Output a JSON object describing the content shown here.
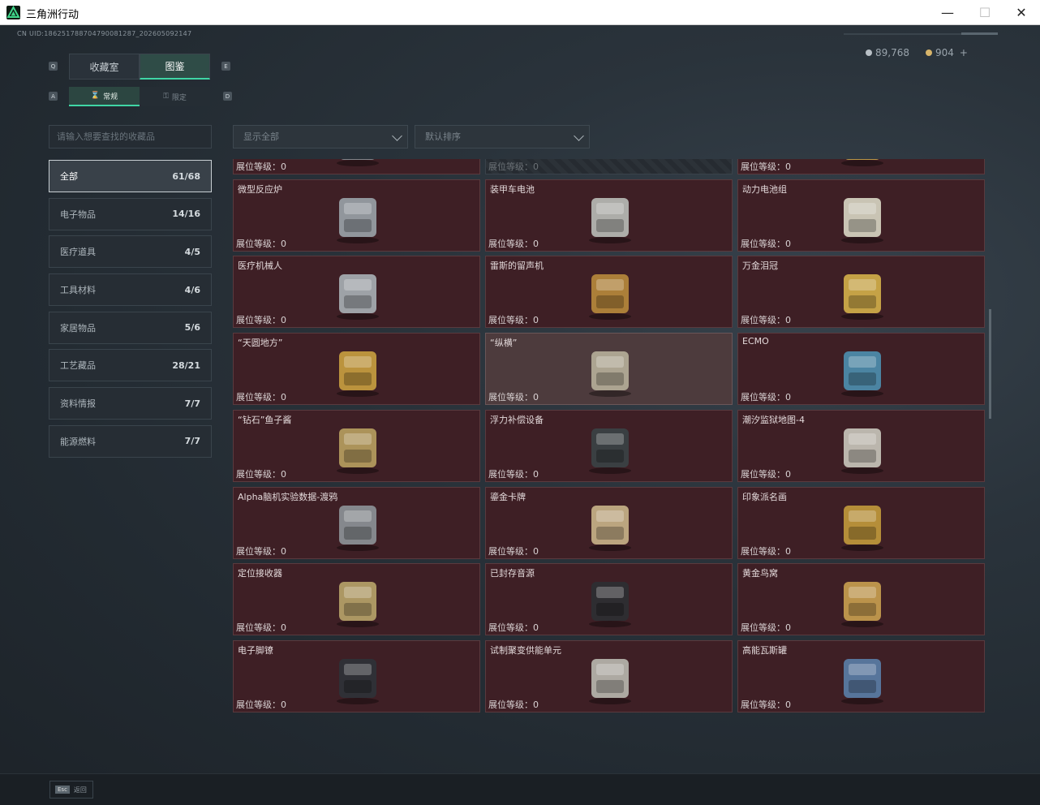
{
  "window": {
    "title": "三角洲行动",
    "min_icon": "minimize-icon",
    "max_icon": "maximize-icon",
    "close_icon": "close-icon"
  },
  "header": {
    "uid": "CN UID:186251788704790081287_202605092147",
    "currency_silver": "89,768",
    "currency_gold": "904",
    "plus": "+"
  },
  "tabs": {
    "key_left": "Q",
    "key_right": "E",
    "items": [
      {
        "label": "收藏室"
      },
      {
        "label": "图鉴"
      }
    ]
  },
  "subtabs": {
    "key_left": "A",
    "key_right": "D",
    "items": [
      {
        "label": "常规"
      },
      {
        "label": "限定"
      }
    ]
  },
  "search": {
    "placeholder": "请输入想要查找的收藏品"
  },
  "filters": {
    "show": "显示全部",
    "sort": "默认排序"
  },
  "categories": [
    {
      "label": "全部",
      "count": "61/68"
    },
    {
      "label": "电子物品",
      "count": "14/16"
    },
    {
      "label": "医疗道具",
      "count": "4/5"
    },
    {
      "label": "工具材料",
      "count": "4/6"
    },
    {
      "label": "家居物品",
      "count": "5/6"
    },
    {
      "label": "工艺藏品",
      "count": "28/21"
    },
    {
      "label": "资料情报",
      "count": "7/7"
    },
    {
      "label": "能源燃料",
      "count": "7/7"
    }
  ],
  "level_label": "展位等级：",
  "items": [
    {
      "name": "",
      "level": "0"
    },
    {
      "name": "",
      "level": "0"
    },
    {
      "name": "",
      "level": "0"
    },
    {
      "name": "微型反应炉",
      "level": "0"
    },
    {
      "name": "装甲车电池",
      "level": "0"
    },
    {
      "name": "动力电池组",
      "level": "0"
    },
    {
      "name": "医疗机械人",
      "level": "0"
    },
    {
      "name": "雷斯的留声机",
      "level": "0"
    },
    {
      "name": "万金泪冠",
      "level": "0"
    },
    {
      "name": "“天圆地方”",
      "level": "0"
    },
    {
      "name": "“纵横”",
      "level": "0"
    },
    {
      "name": "ECMO",
      "level": "0"
    },
    {
      "name": "“钻石”鱼子酱",
      "level": "0"
    },
    {
      "name": "浮力补偿设备",
      "level": "0"
    },
    {
      "name": "潮汐监狱地图-4",
      "level": "0"
    },
    {
      "name": "Alpha脑机实验数据-渡鸦",
      "level": "0"
    },
    {
      "name": "鎏金卡牌",
      "level": "0"
    },
    {
      "name": "印象派名画",
      "level": "0"
    },
    {
      "name": "定位接收器",
      "level": "0"
    },
    {
      "name": "已封存音源",
      "level": "0"
    },
    {
      "name": "黄金鸟窝",
      "level": "0"
    },
    {
      "name": "电子脚镣",
      "level": "0"
    },
    {
      "name": "试制聚变供能单元",
      "level": "0"
    },
    {
      "name": "高能瓦斯罐",
      "level": "0"
    }
  ],
  "footer": {
    "esc_key": "Esc",
    "esc_label": "返回"
  }
}
